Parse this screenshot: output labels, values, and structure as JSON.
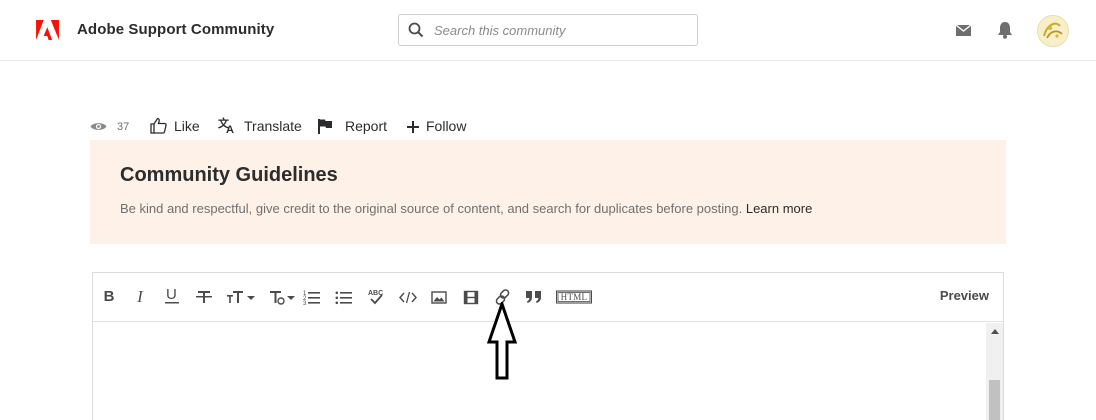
{
  "header": {
    "brand": "Adobe Support Community",
    "search_placeholder": "Search this community",
    "icons": {
      "logo": "adobe-logo",
      "mail": "mail-icon",
      "bell": "bell-icon",
      "avatar": "user-avatar"
    },
    "accent_color": "#fa0f00"
  },
  "actions": {
    "views_count": "37",
    "like": "Like",
    "translate": "Translate",
    "report": "Report",
    "follow": "Follow"
  },
  "guidelines": {
    "title": "Community Guidelines",
    "text": "Be kind and respectful, give credit to the original source of content, and search for duplicates before posting.",
    "link": "Learn more",
    "background": "#fdf1e8"
  },
  "editor": {
    "toolbar": {
      "bold": "B",
      "italic": "I",
      "underline": "U",
      "html": "HTML",
      "preview": "Preview",
      "tools": [
        "bold",
        "italic",
        "underline",
        "strikethrough",
        "font-size",
        "text-format",
        "numbered-list",
        "bulleted-list",
        "spellcheck",
        "code",
        "image",
        "video",
        "link",
        "quote",
        "html"
      ]
    },
    "annotation": "up-arrow pointing at link-icon"
  }
}
